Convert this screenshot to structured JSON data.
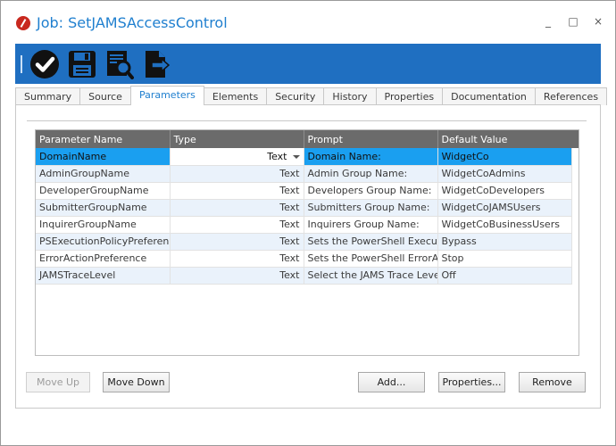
{
  "window": {
    "title": "Job: SetJAMSAccessControl",
    "controls": [
      "_",
      "□",
      "×"
    ]
  },
  "toolbar": {
    "buttons": [
      {
        "name": "check-icon"
      },
      {
        "name": "save-icon"
      },
      {
        "name": "report-search-icon"
      },
      {
        "name": "export-icon"
      }
    ]
  },
  "tabs": [
    "Summary",
    "Source",
    "Parameters",
    "Elements",
    "Security",
    "History",
    "Properties",
    "Documentation",
    "References"
  ],
  "active_tab": "Parameters",
  "grid": {
    "columns": [
      "Parameter Name",
      "Type",
      "Prompt",
      "Default Value"
    ],
    "rows": [
      {
        "name": "DomainName",
        "type": "Text",
        "prompt": "Domain Name:",
        "default": "WidgetCo"
      },
      {
        "name": "AdminGroupName",
        "type": "Text",
        "prompt": "Admin Group Name:",
        "default": "WidgetCoAdmins"
      },
      {
        "name": "DeveloperGroupName",
        "type": "Text",
        "prompt": "Developers Group Name:",
        "default": "WidgetCoDevelopers"
      },
      {
        "name": "SubmitterGroupName",
        "type": "Text",
        "prompt": "Submitters Group Name:",
        "default": "WidgetCoJAMSUsers"
      },
      {
        "name": "InquirerGroupName",
        "type": "Text",
        "prompt": "Inquirers Group Name:",
        "default": "WidgetCoBusinessUsers"
      },
      {
        "name": "PSExecutionPolicyPreference",
        "type": "Text",
        "prompt": "Sets the PowerShell Execu...",
        "default": "Bypass"
      },
      {
        "name": "ErrorActionPreference",
        "type": "Text",
        "prompt": "Sets the PowerShell ErrorA...",
        "default": "Stop"
      },
      {
        "name": "JAMSTraceLevel",
        "type": "Text",
        "prompt": "Select the JAMS Trace Level:",
        "default": "Off"
      }
    ]
  },
  "buttons": {
    "move_up": "Move Up",
    "move_down": "Move Down",
    "add": "Add...",
    "properties": "Properties...",
    "remove": "Remove"
  },
  "colors": {
    "accent": "#1f6fc1",
    "title": "#1f7fcf",
    "selection": "#1a9ff0",
    "header": "#6b6b6b"
  }
}
